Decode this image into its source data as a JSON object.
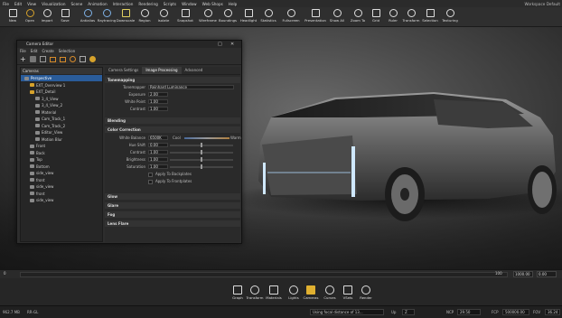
{
  "menu": [
    "File",
    "Edit",
    "View",
    "Visualization",
    "Scene",
    "Animation",
    "Interaction",
    "Rendering",
    "Scripts",
    "Window",
    "Web Shops",
    "Help"
  ],
  "workspace": "Workspace",
  "workspace_value": "Default",
  "toolbar": [
    "New",
    "Open",
    "Import",
    "Save",
    "Antialias",
    "Raytracing",
    "Downscale",
    "Region",
    "Isolate",
    "Snapshot",
    "Wireframe",
    "Boundings",
    "Headlight",
    "Statistics",
    "Fullscreen",
    "Presentation",
    "Show All",
    "Zoom To",
    "Grid",
    "Ruler",
    "Transform",
    "Selection",
    "Texturing"
  ],
  "camera_editor": {
    "title": "Camera Editor",
    "menu": [
      "File",
      "Edit",
      "Create",
      "Selection"
    ],
    "tree_header": "Cameras",
    "tree": [
      {
        "label": "Perspective",
        "selected": true
      },
      {
        "label": "EXT_Overview 1"
      },
      {
        "label": "EXT_Detail"
      },
      {
        "label": "3_4_View"
      },
      {
        "label": "3_4_View_2"
      },
      {
        "label": "Material"
      },
      {
        "label": "Cam_Track_1"
      },
      {
        "label": "Cam_Track_2"
      },
      {
        "label": "Editor_View"
      },
      {
        "label": "Motion Blur"
      },
      {
        "label": "Front"
      },
      {
        "label": "Back"
      },
      {
        "label": "Top"
      },
      {
        "label": "Bottom"
      },
      {
        "label": "side_view"
      },
      {
        "label": "front"
      },
      {
        "label": "side_view"
      },
      {
        "label": "front"
      },
      {
        "label": "side_view"
      }
    ],
    "tabs": [
      "Camera Settings",
      "Image Processing",
      "Advanced"
    ],
    "active_tab": "Image Processing",
    "tonemapping": {
      "section": "Tonemapping",
      "tonemapper_label": "Tonemapper",
      "tonemapper_value": "Reinhard Luminance",
      "exposure_label": "Exposure",
      "exposure_value": "2.00",
      "white_point_label": "White Point",
      "white_point_value": "1.00",
      "contrast_label": "Contrast",
      "contrast_value": "1.00"
    },
    "blending_section": "Blending",
    "color_correction": {
      "section": "Color Correction",
      "white_balance_label": "White Balance",
      "white_balance_value": "6500K",
      "cool_label": "Cool",
      "warm_label": "Warm",
      "hue_shift_label": "Hue Shift",
      "hue_shift_value": "0.00",
      "contrast_label": "Contrast",
      "contrast_value": "1.00",
      "brightness_label": "Brightness",
      "brightness_value": "1.00",
      "saturation_label": "Saturation",
      "saturation_value": "1.00",
      "apply_backplates": "Apply To Backplates",
      "apply_frontplates": "Apply To Frontplates"
    },
    "sections_bottom": [
      "Glow",
      "Glare",
      "Fog",
      "Lens Flare"
    ]
  },
  "timeline": {
    "start": "0",
    "end": "100",
    "end_field": "1000.00",
    "frame": "0.00"
  },
  "dock": [
    "Graph",
    "Transform",
    "Materials",
    "Lights",
    "Cameras",
    "Curves",
    "VSets",
    "Render"
  ],
  "status": {
    "memory": "962.7 MB",
    "mode": "RR-GL",
    "message": "Using focal distance of 13...",
    "up_label": "Up",
    "up_value": "Z",
    "ncp_label": "NCP",
    "ncp_value": "29.50",
    "fcp_label": "FCP",
    "fcp_value": "500000.00",
    "fov_label": "FOV",
    "fov_value": "36.24"
  },
  "colors": {
    "accent_orange": "#d68b2b",
    "selection_blue": "#2a5c9a",
    "car_light": "#cfe8ff"
  }
}
